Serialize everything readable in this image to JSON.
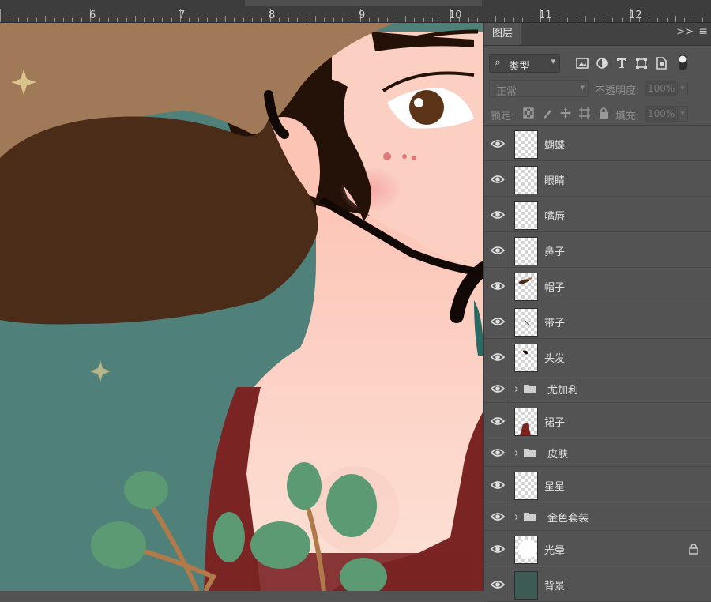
{
  "ruler": {
    "numbers": [
      "6",
      "7",
      "8",
      "9",
      "10",
      "11",
      "12"
    ]
  },
  "panel": {
    "tab_label": "图层",
    "collapse_icon": "double-chevron-right-icon",
    "menu_icon": "menu-icon",
    "filter": {
      "label": "类型",
      "icon": "search-icon"
    },
    "blend_mode": "正常",
    "opacity_label": "不透明度:",
    "opacity_value": "100%",
    "lock_label": "锁定:",
    "fill_label": "填充:",
    "fill_value": "100%"
  },
  "layers": [
    {
      "name": "蝴蝶",
      "type": "layer",
      "thumb": "blank"
    },
    {
      "name": "眼睛",
      "type": "layer",
      "thumb": "blank"
    },
    {
      "name": "嘴唇",
      "type": "layer",
      "thumb": "blank"
    },
    {
      "name": "鼻子",
      "type": "layer",
      "thumb": "blank"
    },
    {
      "name": "帽子",
      "type": "layer",
      "thumb": "hat"
    },
    {
      "name": "带子",
      "type": "layer",
      "thumb": "strap"
    },
    {
      "name": "头发",
      "type": "layer",
      "thumb": "hair"
    },
    {
      "name": "尤加利",
      "type": "group"
    },
    {
      "name": "裙子",
      "type": "layer",
      "thumb": "dress"
    },
    {
      "name": "皮肤",
      "type": "group"
    },
    {
      "name": "星星",
      "type": "layer",
      "thumb": "blank"
    },
    {
      "name": "金色套装",
      "type": "group"
    },
    {
      "name": "光晕",
      "type": "layer",
      "thumb": "glow",
      "locked": true
    },
    {
      "name": "背景",
      "type": "layer",
      "thumb": "solid",
      "color": "#3d5a54"
    }
  ],
  "colors": {
    "canvas_bg": "#4f807a",
    "hat": "#a07a58",
    "hat_shadow": "#4a2c18",
    "skin": "#fbd0c2",
    "dress": "#7a2424",
    "leaf": "#5b9a73",
    "stem": "#b07a4a"
  }
}
